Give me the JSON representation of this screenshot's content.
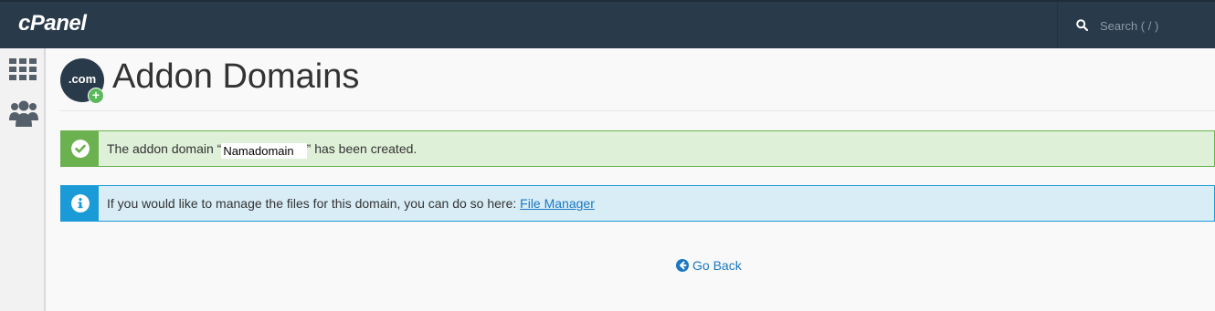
{
  "header": {
    "logo_text": "cPanel",
    "search_placeholder": "Search ( / )"
  },
  "sidebar": {
    "items": [
      {
        "icon": "grid-icon"
      },
      {
        "icon": "users-icon"
      }
    ]
  },
  "page": {
    "icon_text": ".com",
    "icon_badge": "+",
    "title": "Addon Domains"
  },
  "alerts": {
    "success": {
      "prefix": "The addon domain “",
      "domain": "Namadomain",
      "suffix": "” has been created."
    },
    "info": {
      "text": "If you would like to manage the files for this domain, you can do so here: ",
      "link_label": "File Manager"
    }
  },
  "go_back_label": "Go Back",
  "colors": {
    "header_bg": "#293a4a",
    "success_accent": "#6cb14f",
    "success_bg": "#dff0d8",
    "info_accent": "#1a9bd7",
    "info_bg": "#d9edf7",
    "link": "#1a78c2"
  }
}
